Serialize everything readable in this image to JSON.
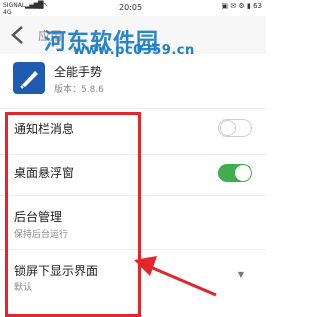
{
  "status_bar": {
    "carrier_line1": "SIGNAL",
    "carrier_line2": "4G",
    "signal": "▂▄▆█",
    "time": "20:05",
    "battery": "63"
  },
  "app_bar": {
    "title": "应用"
  },
  "watermark": {
    "title": "河东软件园",
    "url": "www.pc0359.cn"
  },
  "app_info": {
    "name": "全能手势",
    "version": "版本：5.8.6"
  },
  "settings": [
    {
      "label": "通知栏消息",
      "toggle": "off"
    },
    {
      "label": "桌面悬浮窗",
      "toggle": "on"
    },
    {
      "label": "后台管理",
      "sublabel": "保持后台运行"
    },
    {
      "label": "锁屏下显示界面",
      "sublabel": "默认"
    }
  ],
  "colors": {
    "accent_green": "#3fae4e",
    "annotation_red": "#e3262b",
    "watermark_blue": "#1e7fc8"
  }
}
